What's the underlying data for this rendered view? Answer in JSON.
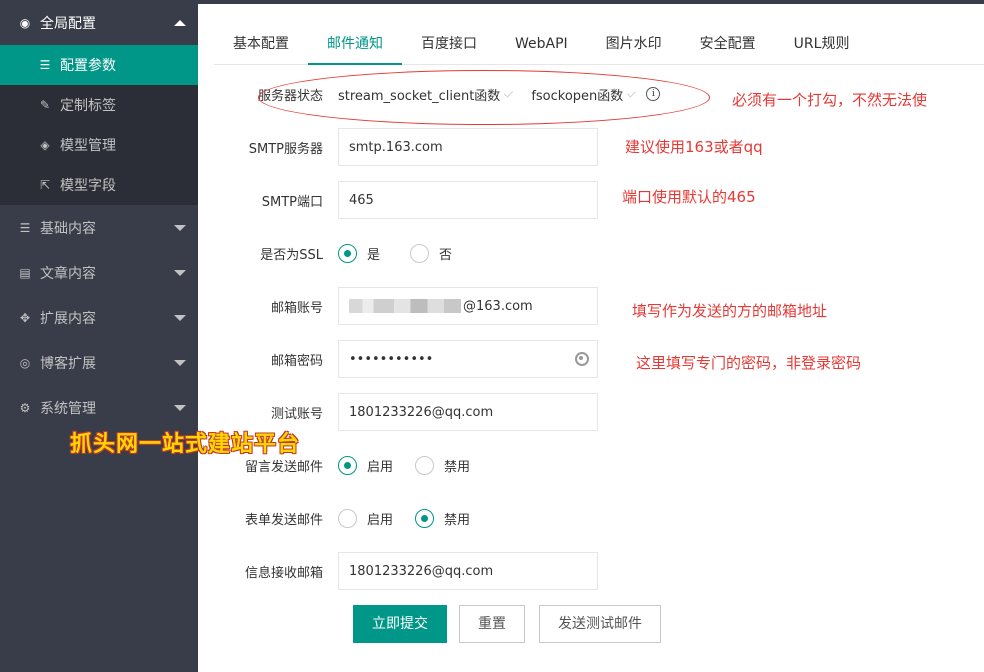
{
  "sidebar": {
    "groups": [
      {
        "label": "全局配置",
        "icon": "globe-icon"
      },
      {
        "label": "基础内容",
        "icon": "sliders-icon"
      },
      {
        "label": "文章内容",
        "icon": "document-icon"
      },
      {
        "label": "扩展内容",
        "icon": "expand-icon"
      },
      {
        "label": "博客扩展",
        "icon": "location-icon"
      },
      {
        "label": "系统管理",
        "icon": "gear-icon"
      }
    ],
    "sub_items": [
      {
        "label": "配置参数",
        "icon": "sliders-icon"
      },
      {
        "label": "定制标签",
        "icon": "wrench-icon"
      },
      {
        "label": "模型管理",
        "icon": "cube-icon"
      },
      {
        "label": "模型字段",
        "icon": "external-link-icon"
      }
    ]
  },
  "watermark": "抓头网一站式建站平台",
  "tabs": [
    "基本配置",
    "邮件通知",
    "百度接口",
    "WebAPI",
    "图片水印",
    "安全配置",
    "URL规则"
  ],
  "form": {
    "server_status": {
      "label": "服务器状态",
      "option1": "stream_socket_client函数",
      "option2": "fsockopen函数"
    },
    "smtp_server": {
      "label": "SMTP服务器",
      "value": "smtp.163.com"
    },
    "smtp_port": {
      "label": "SMTP端口",
      "value": "465"
    },
    "ssl": {
      "label": "是否为SSL",
      "yes": "是",
      "no": "否"
    },
    "email_account": {
      "label": "邮箱账号",
      "value_suffix": "@163.com"
    },
    "email_password": {
      "label": "邮箱密码",
      "value": "•••••••••••"
    },
    "test_account": {
      "label": "测试账号",
      "value": "1801233226@qq.com"
    },
    "comment_mail": {
      "label": "留言发送邮件",
      "enable": "启用",
      "disable": "禁用"
    },
    "form_mail": {
      "label": "表单发送邮件",
      "enable": "启用",
      "disable": "禁用"
    },
    "receive_mail": {
      "label": "信息接收邮箱",
      "value": "1801233226@qq.com"
    }
  },
  "notes": {
    "status": "必须有一个打勾，不然无法使",
    "smtp": "建议使用163或者qq",
    "port": "端口使用默认的465",
    "account": "填写作为发送的方的邮箱地址",
    "password": "这里填写专门的密码，非登录密码"
  },
  "buttons": {
    "submit": "立即提交",
    "reset": "重置",
    "test": "发送测试邮件"
  },
  "colors": {
    "accent": "#009688",
    "sidebar": "#393d49",
    "annotation": "#e53935"
  }
}
